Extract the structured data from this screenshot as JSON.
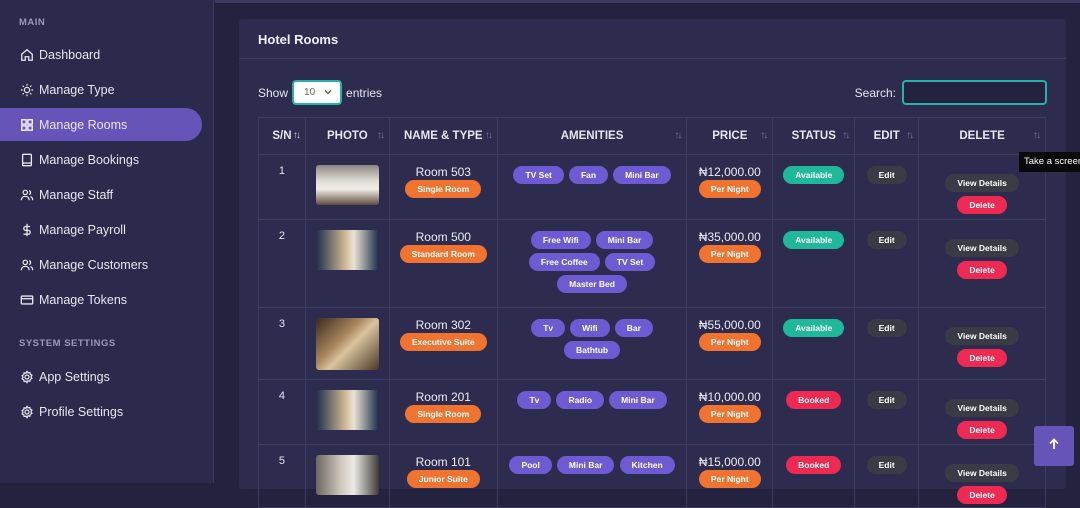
{
  "sidebar": {
    "sections": [
      {
        "label": "MAIN"
      },
      {
        "label": "SYSTEM SETTINGS"
      }
    ],
    "items": [
      {
        "label": "Dashboard",
        "icon": "home-icon"
      },
      {
        "label": "Manage Type",
        "icon": "sun-icon"
      },
      {
        "label": "Manage Rooms",
        "icon": "grid-icon",
        "active": true
      },
      {
        "label": "Manage Bookings",
        "icon": "book-icon"
      },
      {
        "label": "Manage Staff",
        "icon": "users-icon"
      },
      {
        "label": "Manage Payroll",
        "icon": "dollar-icon"
      },
      {
        "label": "Manage Customers",
        "icon": "users-icon"
      },
      {
        "label": "Manage Tokens",
        "icon": "card-icon"
      },
      {
        "label": "App Settings",
        "icon": "gear-icon"
      },
      {
        "label": "Profile Settings",
        "icon": "gear-icon"
      }
    ]
  },
  "card": {
    "title": "Hotel Rooms",
    "show_label": "Show",
    "entries_value": "10",
    "entries_label": "entries",
    "search_label": "Search:",
    "search_value": ""
  },
  "table": {
    "headers": [
      "S/N",
      "PHOTO",
      "NAME & TYPE",
      "AMENITIES",
      "PRICE",
      "STATUS",
      "EDIT",
      "DELETE"
    ],
    "rows": [
      {
        "sn": "1",
        "name": "Room 503",
        "type": "Single Room",
        "amenities": [
          "TV Set",
          "Fan",
          "Mini Bar"
        ],
        "price": "₦12,000.00",
        "per": "Per Night",
        "status": "Available",
        "edit": "Edit",
        "view": "View Details",
        "delete": "Delete"
      },
      {
        "sn": "2",
        "name": "Room 500",
        "type": "Standard Room",
        "amenities": [
          "Free Wifi",
          "Mini Bar",
          "Free Coffee",
          "TV Set",
          "Master Bed"
        ],
        "price": "₦35,000.00",
        "per": "Per Night",
        "status": "Available",
        "edit": "Edit",
        "view": "View Details",
        "delete": "Delete"
      },
      {
        "sn": "3",
        "name": "Room 302",
        "type": "Executive Suite",
        "amenities": [
          "Tv",
          "Wifi",
          "Bar",
          "Bathtub"
        ],
        "price": "₦55,000.00",
        "per": "Per Night",
        "status": "Available",
        "edit": "Edit",
        "view": "View Details",
        "delete": "Delete"
      },
      {
        "sn": "4",
        "name": "Room 201",
        "type": "Single Room",
        "amenities": [
          "Tv",
          "Radio",
          "Mini Bar"
        ],
        "price": "₦10,000.00",
        "per": "Per Night",
        "status": "Booked",
        "edit": "Edit",
        "view": "View Details",
        "delete": "Delete"
      },
      {
        "sn": "5",
        "name": "Room 101",
        "type": "Junior Suite",
        "amenities": [
          "Pool",
          "Mini Bar",
          "Kitchen"
        ],
        "price": "₦15,000.00",
        "per": "Per Night",
        "status": "Booked",
        "edit": "Edit",
        "view": "View Details",
        "delete": "Delete"
      }
    ]
  },
  "tooltip": "Take a screenshot",
  "colors": {
    "accent": "#6654b8",
    "available": "#1fb89a",
    "booked": "#ef2a52",
    "type_badge": "#f07430",
    "amenity": "#6c5bd3"
  }
}
